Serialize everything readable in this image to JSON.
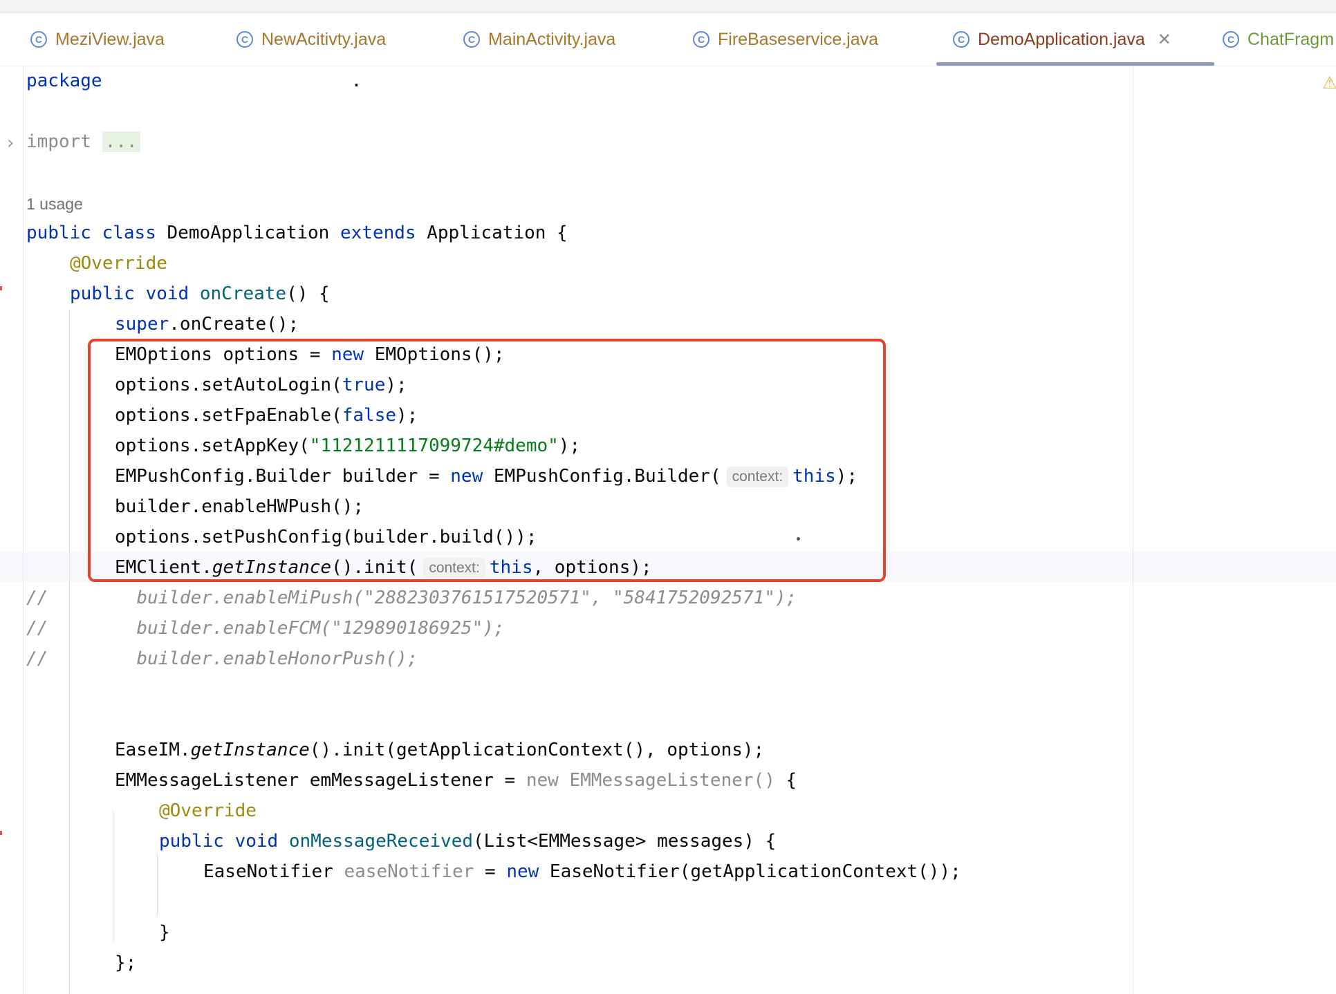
{
  "tabs": [
    {
      "label": "MeziView.java",
      "active": false
    },
    {
      "label": "NewAcitivty.java",
      "active": false
    },
    {
      "label": "MainActivity.java",
      "active": false
    },
    {
      "label": "FireBaseservice.java",
      "active": false
    },
    {
      "label": "DemoApplication.java",
      "active": true
    },
    {
      "label": "ChatFragm",
      "active": false
    }
  ],
  "tab_close_glyph": "✕",
  "class_icon_glyph": "C",
  "code": {
    "package_kw": "package",
    "package_dot": ".",
    "import_kw": "import",
    "import_fold": "...",
    "usage": "1 usage",
    "l_class": {
      "k1": "public",
      "k2": "class",
      "name": "DemoApplication",
      "k3": "extends",
      "parent": "Application {"
    },
    "l_override1": "@Override",
    "l_oncreate": {
      "k1": "public",
      "k2": "void",
      "fn": "onCreate",
      "rest": "() {"
    },
    "l_super": {
      "kw": "super",
      "rest": ".onCreate();"
    },
    "l_emoptions": {
      "a": "EMOptions options = ",
      "kw": "new",
      "b": " EMOptions();"
    },
    "l_autologin": {
      "a": "options.setAutoLogin(",
      "kw": "true",
      "b": ");"
    },
    "l_fpa": {
      "a": "options.setFpaEnable(",
      "kw": "false",
      "b": ");"
    },
    "l_appkey": {
      "a": "options.setAppKey(",
      "str": "\"1121211117099724#demo\"",
      "b": ");"
    },
    "l_builder": {
      "a": "EMPushConfig.Builder builder = ",
      "kw": "new",
      "b": " EMPushConfig.Builder(",
      "hint": "context:",
      "kw2": "this",
      "c": ");"
    },
    "l_hw": "builder.enableHWPush();",
    "l_setpush": "options.setPushConfig(builder.build());",
    "l_init": {
      "a": "EMClient.",
      "it": "getInstance",
      "b": "().init(",
      "hint": "context:",
      "kw": "this",
      "c": ", options);"
    },
    "c1": {
      "slashes": "//",
      "body": "builder.enableMiPush(\"2882303761517520571\", \"5841752092571\");"
    },
    "c2": {
      "slashes": "//",
      "body": "builder.enableFCM(\"129890186925\");"
    },
    "c3": {
      "slashes": "//",
      "body": "builder.enableHonorPush();"
    },
    "l_easeim": {
      "a": "EaseIM.",
      "it": "getInstance",
      "b": "().init(getApplicationContext(), options);"
    },
    "l_listener": {
      "a": "EMMessageListener emMessageListener = ",
      "g": "new EMMessageListener()",
      "b": " {"
    },
    "l_override2": "@Override",
    "l_onmsg": {
      "k1": "public",
      "k2": "void",
      "fn": "onMessageReceived",
      "rest": "(List<EMMessage> messages) {"
    },
    "l_notifier": {
      "a": "EaseNotifier ",
      "g": "easeNotifier",
      "b": " = ",
      "kw": "new",
      "c": " EaseNotifier(getApplicationContext());"
    },
    "l_close1": "}",
    "l_close2": "};"
  }
}
